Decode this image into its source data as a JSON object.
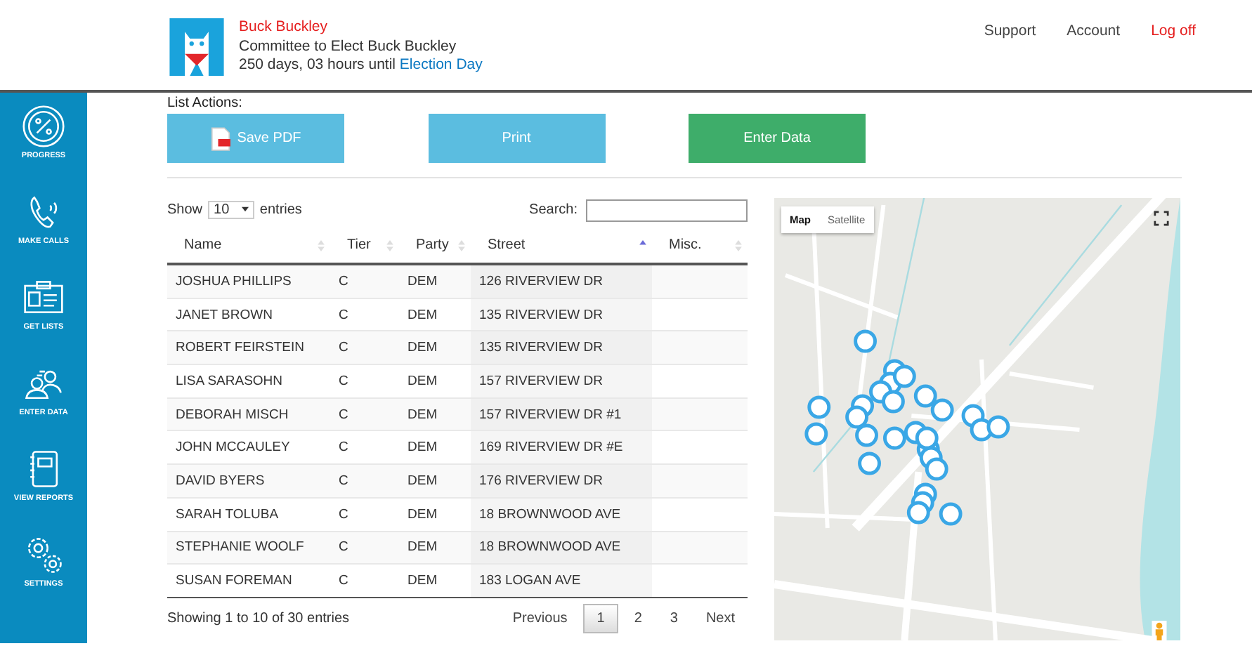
{
  "header": {
    "name": "Buck Buckley",
    "committee": "Committee to Elect Buck Buckley",
    "countdown": "250 days, 03 hours until",
    "countdown_link": "Election Day",
    "links": [
      {
        "label": "Support",
        "kind": "plain"
      },
      {
        "label": "Account",
        "kind": "plain"
      },
      {
        "label": "Log off",
        "kind": "alert"
      }
    ]
  },
  "sidebar": {
    "items": [
      {
        "label": "PROGRESS"
      },
      {
        "label": "MAKE CALLS"
      },
      {
        "label": "GET LISTS"
      },
      {
        "label": "ENTER DATA"
      },
      {
        "label": "VIEW REPORTS"
      },
      {
        "label": "SETTINGS"
      }
    ]
  },
  "list_actions": {
    "title": "List Actions:",
    "buttons": [
      {
        "label": "Save PDF",
        "kind": "pdf"
      },
      {
        "label": "Print",
        "kind": "plain"
      },
      {
        "label": "Enter Data",
        "kind": "go"
      }
    ]
  },
  "table": {
    "show_label": "Show",
    "page_size": "10",
    "entries_label": "entries",
    "search_label": "Search:",
    "columns": [
      {
        "label": "Name",
        "sorted": false
      },
      {
        "label": "Tier",
        "sorted": false
      },
      {
        "label": "Party",
        "sorted": false
      },
      {
        "label": "Street",
        "sorted": true
      },
      {
        "label": "Misc.",
        "sorted": false
      }
    ],
    "rows": [
      [
        "JOSHUA PHILLIPS",
        "C",
        "DEM",
        "126 RIVERVIEW DR",
        ""
      ],
      [
        "JANET BROWN",
        "C",
        "DEM",
        "135 RIVERVIEW DR",
        ""
      ],
      [
        "ROBERT FEIRSTEIN",
        "C",
        "DEM",
        "135 RIVERVIEW DR",
        ""
      ],
      [
        "LISA SARASOHN",
        "C",
        "DEM",
        "157 RIVERVIEW DR",
        ""
      ],
      [
        "DEBORAH MISCH",
        "C",
        "DEM",
        "157 RIVERVIEW DR #1",
        ""
      ],
      [
        "JOHN MCCAULEY",
        "C",
        "DEM",
        "169 RIVERVIEW DR #E",
        ""
      ],
      [
        "DAVID BYERS",
        "C",
        "DEM",
        "176 RIVERVIEW DR",
        ""
      ],
      [
        "SARAH TOLUBA",
        "C",
        "DEM",
        "18 BROWNWOOD AVE",
        ""
      ],
      [
        "STEPHANIE WOOLF",
        "C",
        "DEM",
        "18 BROWNWOOD AVE",
        ""
      ],
      [
        "SUSAN FOREMAN",
        "C",
        "DEM",
        "183 LOGAN AVE",
        ""
      ]
    ],
    "info": "Showing 1 to 10 of 30 entries",
    "previous": "Previous",
    "next": "Next",
    "pages": [
      {
        "label": "1",
        "selected": true
      },
      {
        "label": "2",
        "selected": false
      },
      {
        "label": "3",
        "selected": false
      }
    ]
  },
  "map": {
    "kind": "picture",
    "types": [
      {
        "label": "Map",
        "selected": true
      },
      {
        "label": "Satellite",
        "selected": false
      }
    ]
  }
}
